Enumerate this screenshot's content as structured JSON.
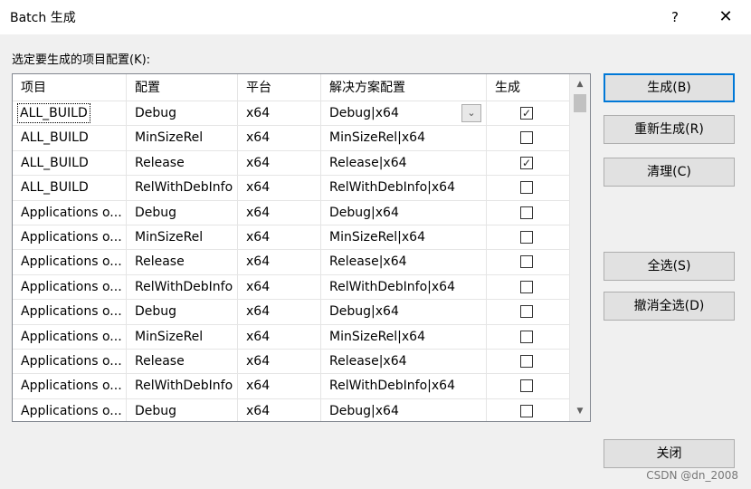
{
  "window": {
    "title": "Batch 生成",
    "help": "?",
    "close": "✕"
  },
  "prompt": "选定要生成的项目配置(K):",
  "columns": [
    "项目",
    "配置",
    "平台",
    "解决方案配置",
    "生成"
  ],
  "rows": [
    {
      "project": "ALL_BUILD",
      "config": "Debug",
      "platform": "x64",
      "solution": "Debug|x64",
      "build": true
    },
    {
      "project": "ALL_BUILD",
      "config": "MinSizeRel",
      "platform": "x64",
      "solution": "MinSizeRel|x64",
      "build": false
    },
    {
      "project": "ALL_BUILD",
      "config": "Release",
      "platform": "x64",
      "solution": "Release|x64",
      "build": true
    },
    {
      "project": "ALL_BUILD",
      "config": "RelWithDebInfo",
      "platform": "x64",
      "solution": "RelWithDebInfo|x64",
      "build": false
    },
    {
      "project": "Applications o...",
      "config": "Debug",
      "platform": "x64",
      "solution": "Debug|x64",
      "build": false
    },
    {
      "project": "Applications o...",
      "config": "MinSizeRel",
      "platform": "x64",
      "solution": "MinSizeRel|x64",
      "build": false
    },
    {
      "project": "Applications o...",
      "config": "Release",
      "platform": "x64",
      "solution": "Release|x64",
      "build": false
    },
    {
      "project": "Applications o...",
      "config": "RelWithDebInfo",
      "platform": "x64",
      "solution": "RelWithDebInfo|x64",
      "build": false
    },
    {
      "project": "Applications o...",
      "config": "Debug",
      "platform": "x64",
      "solution": "Debug|x64",
      "build": false
    },
    {
      "project": "Applications o...",
      "config": "MinSizeRel",
      "platform": "x64",
      "solution": "MinSizeRel|x64",
      "build": false
    },
    {
      "project": "Applications o...",
      "config": "Release",
      "platform": "x64",
      "solution": "Release|x64",
      "build": false
    },
    {
      "project": "Applications o...",
      "config": "RelWithDebInfo",
      "platform": "x64",
      "solution": "RelWithDebInfo|x64",
      "build": false
    },
    {
      "project": "Applications o...",
      "config": "Debug",
      "platform": "x64",
      "solution": "Debug|x64",
      "build": false
    }
  ],
  "buttons": {
    "build": "生成(B)",
    "rebuild": "重新生成(R)",
    "clean": "清理(C)",
    "select_all": "全选(S)",
    "deselect_all": "撤消全选(D)",
    "close": "关闭"
  },
  "watermark": "CSDN @dn_2008",
  "icons": {
    "check": "✓",
    "dropdown": "chevron-down-icon",
    "scroll_up": "▲",
    "scroll_down": "▼"
  }
}
